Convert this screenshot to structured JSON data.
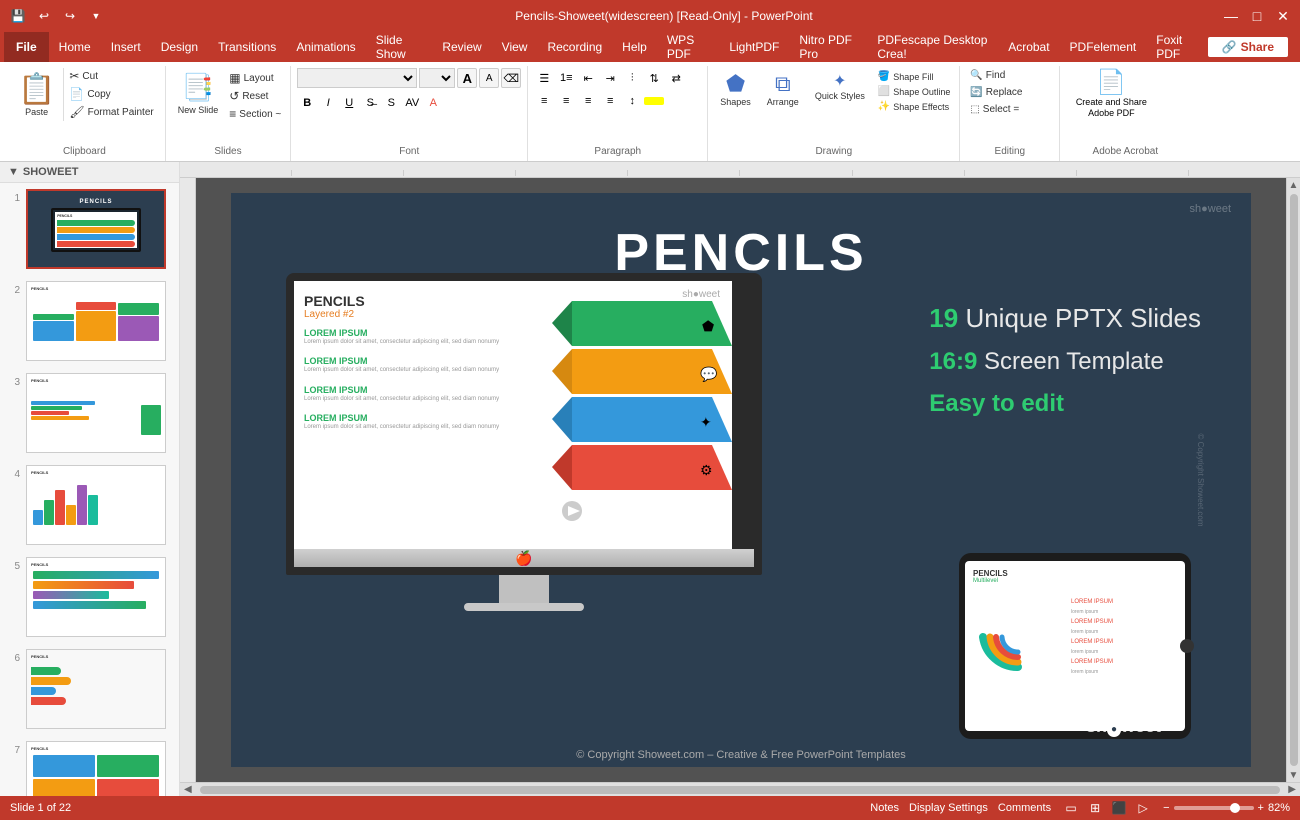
{
  "titlebar": {
    "title": "Pencils-Showeet(widescreen) [Read-Only] - PowerPoint",
    "save_icon": "💾",
    "undo_icon": "↩",
    "redo_icon": "↪",
    "customize_icon": "▼",
    "minimize": "—",
    "maximize": "□",
    "close": "✕"
  },
  "menubar": {
    "file": "File",
    "items": [
      "Home",
      "Insert",
      "Design",
      "Transitions",
      "Animations",
      "Slide Show",
      "Review",
      "View",
      "Recording",
      "Help",
      "WPS PDF",
      "LightPDF",
      "Nitro PDF Pro",
      "PDFescape Desktop Crea!",
      "Acrobat",
      "PDFelement",
      "Foxit PDF"
    ],
    "share": "Share"
  },
  "ribbon": {
    "clipboard_label": "Clipboard",
    "slides_label": "Slides",
    "font_label": "Font",
    "paragraph_label": "Paragraph",
    "drawing_label": "Drawing",
    "editing_label": "Editing",
    "acrobat_label": "Adobe Acrobat",
    "paste_label": "Paste",
    "new_slide_label": "New Slide",
    "layout_label": "Layout",
    "reset_label": "Reset",
    "section_label": "Section ~",
    "font_name": "",
    "font_size": "",
    "bold": "B",
    "italic": "I",
    "underline": "U",
    "shapes_label": "Shapes",
    "arrange_label": "Arrange",
    "quick_styles_label": "Quick Styles",
    "shape_fill_label": "Shape Fill",
    "shape_outline_label": "Shape Outline",
    "shape_effects_label": "Shape Effects",
    "find_label": "Find",
    "replace_label": "Replace",
    "select_label": "Select =",
    "create_share_label": "Create and Share Adobe PDF"
  },
  "slide_panel": {
    "header": "SHOWEET",
    "slides": [
      {
        "num": "1",
        "type": "title"
      },
      {
        "num": "2",
        "type": "bars"
      },
      {
        "num": "3",
        "type": "mixed"
      },
      {
        "num": "4",
        "type": "chart"
      },
      {
        "num": "5",
        "type": "lines"
      },
      {
        "num": "6",
        "type": "colored"
      },
      {
        "num": "7",
        "type": "grid"
      }
    ]
  },
  "main_slide": {
    "title": "PENCILS",
    "monitor_slide_title": "PENCILS",
    "monitor_slide_sub": "Layered #2",
    "showeet_brand": "sh●weet",
    "lorem1": "LOREM IPSUM",
    "lorem2": "LOREM IPSUM",
    "lorem3": "LOREM IPSUM",
    "lorem4": "LOREM IPSUM",
    "feature1_num": "19",
    "feature1_text": "Unique PPTX Slides",
    "feature2_num": "16:9",
    "feature2_text": "Screen Template",
    "feature3_text": "Easy to edit",
    "tablet_title": "PENCILS",
    "tablet_sub": "Multilevel",
    "copyright": "© Copyright Showeet.com – Creative & Free PowerPoint Templates"
  },
  "statusbar": {
    "slide_info": "Slide 1 of 22",
    "notes_label": "Notes",
    "display_settings_label": "Display Settings",
    "comments_label": "Comments",
    "zoom_level": "82%"
  }
}
